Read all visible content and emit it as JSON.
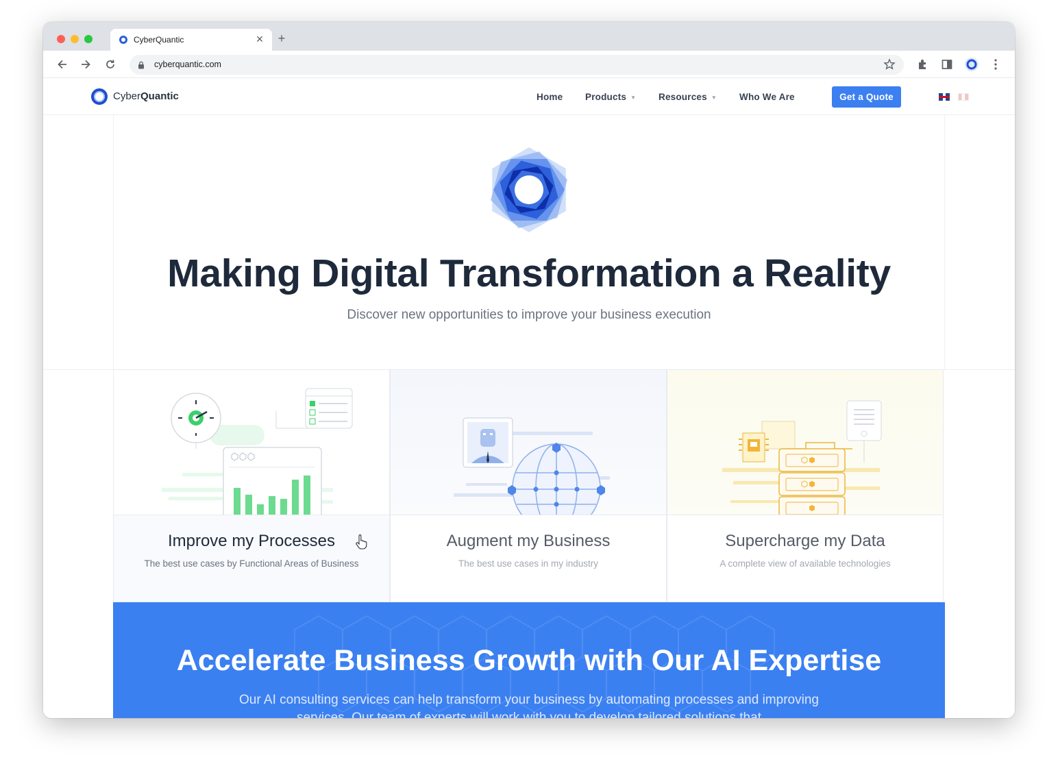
{
  "browser": {
    "tab_title": "CyberQuantic",
    "url": "cyberquantic.com"
  },
  "nav": {
    "logo_light": "Cyber",
    "logo_bold": "Quantic",
    "items": [
      {
        "label": "Home"
      },
      {
        "label": "Products"
      },
      {
        "label": "Resources"
      },
      {
        "label": "Who We Are"
      }
    ],
    "cta": "Get a Quote",
    "languages": [
      "English",
      "Français"
    ]
  },
  "hero": {
    "title": "Making Digital Transformation a Reality",
    "subtitle": "Discover new opportunities to improve your business execution"
  },
  "cards": [
    {
      "title": "Improve my Processes",
      "subtitle": "The best use cases by Functional Areas of Business",
      "accent": "#3ccf6b"
    },
    {
      "title": "Augment my Business",
      "subtitle": "The best use cases in my industry",
      "accent": "#4f86e8"
    },
    {
      "title": "Supercharge my Data",
      "subtitle": "A complete view of available technologies",
      "accent": "#f2b53a"
    }
  ],
  "band": {
    "title": "Accelerate Business Growth with Our AI Expertise",
    "text": "Our AI consulting services can help transform your business by automating processes and improving services. Our team of experts will work with you to develop tailored solutions that",
    "color": "#3b80f1"
  }
}
